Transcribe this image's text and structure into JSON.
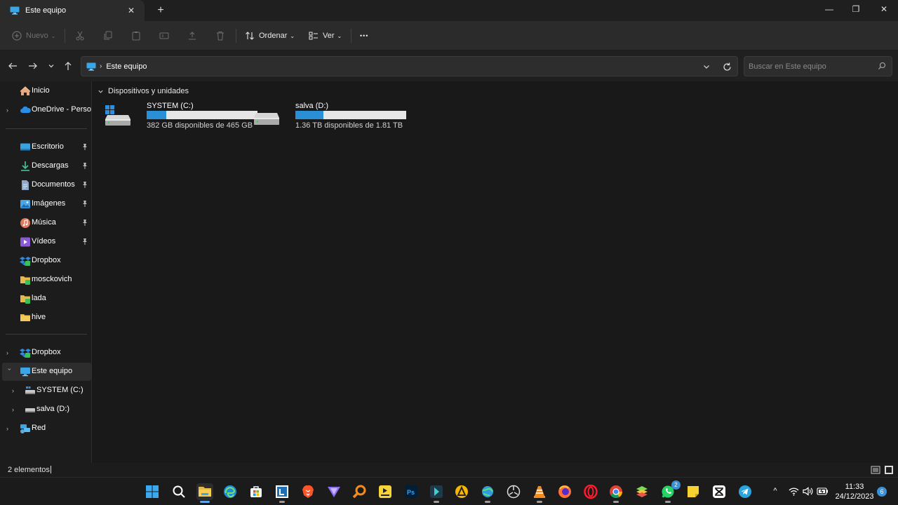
{
  "tab": {
    "title": "Este equipo",
    "close_glyph": "✕",
    "new_tab_glyph": "+"
  },
  "window_controls": {
    "minimize": "—",
    "maximize": "❐",
    "close": "✕"
  },
  "toolbar": {
    "new_label": "Nuevo",
    "sort_label": "Ordenar",
    "view_label": "Ver",
    "more_glyph": "•••",
    "chevron": "⌄"
  },
  "address": {
    "separator": "›",
    "location": "Este equipo",
    "search_placeholder": "Buscar en Este equipo"
  },
  "sidebar": {
    "items": [
      {
        "label": "Inicio",
        "icon": "home-icon"
      },
      {
        "label": "OneDrive - Personal",
        "icon": "onedrive-icon"
      },
      {
        "label": "Escritorio",
        "icon": "desktop-icon",
        "pinned": true
      },
      {
        "label": "Descargas",
        "icon": "downloads-icon",
        "pinned": true
      },
      {
        "label": "Documentos",
        "icon": "documents-icon",
        "pinned": true
      },
      {
        "label": "Imágenes",
        "icon": "pictures-icon",
        "pinned": true
      },
      {
        "label": "Música",
        "icon": "music-icon",
        "pinned": true
      },
      {
        "label": "Vídeos",
        "icon": "videos-icon",
        "pinned": true
      },
      {
        "label": "Dropbox",
        "icon": "dropbox-icon"
      },
      {
        "label": "mosckovich",
        "icon": "folder-icon"
      },
      {
        "label": "lada",
        "icon": "folder-icon"
      },
      {
        "label": "hive",
        "icon": "folder-icon"
      },
      {
        "label": "Dropbox",
        "icon": "dropbox-icon"
      },
      {
        "label": "Este equipo",
        "icon": "this-pc-icon",
        "selected": true
      },
      {
        "label": "SYSTEM (C:)",
        "icon": "system-drive-icon"
      },
      {
        "label": "salva (D:)",
        "icon": "drive-icon"
      },
      {
        "label": "Red",
        "icon": "network-icon"
      }
    ]
  },
  "content": {
    "group_title": "Dispositivos y unidades",
    "drives": [
      {
        "name": "SYSTEM (C:)",
        "space": "382 GB disponibles de 465 GB",
        "used_fraction": 0.18
      },
      {
        "name": "salva (D:)",
        "space": "1.36 TB disponibles de 1.81 TB",
        "used_fraction": 0.25
      }
    ]
  },
  "status": {
    "item_count": "2 elementos"
  },
  "taskbar": {
    "apps": [
      "start-icon",
      "search-icon",
      "file-explorer-icon",
      "edge-icon",
      "store-icon",
      "libreoffice-icon",
      "brave-icon",
      "proton-vpn-icon",
      "search-tool-icon",
      "player-icon",
      "photoshop-icon",
      "media-app-icon",
      "aimp-icon",
      "globe-app-icon",
      "camera-app-icon",
      "vlc-icon",
      "firefox-icon",
      "opera-icon",
      "chrome-icon",
      "bluestacks-icon",
      "whatsapp-icon",
      "sticky-notes-icon",
      "capcut-icon",
      "telegram-icon"
    ],
    "whatsapp_badge": "2",
    "tray_chevron": "^",
    "time": "11:33",
    "date": "24/12/2023",
    "notification_count": "6"
  },
  "colors": {
    "accent": "#2b8fd6",
    "background": "#191919",
    "toolbar": "#2b2b2b"
  }
}
